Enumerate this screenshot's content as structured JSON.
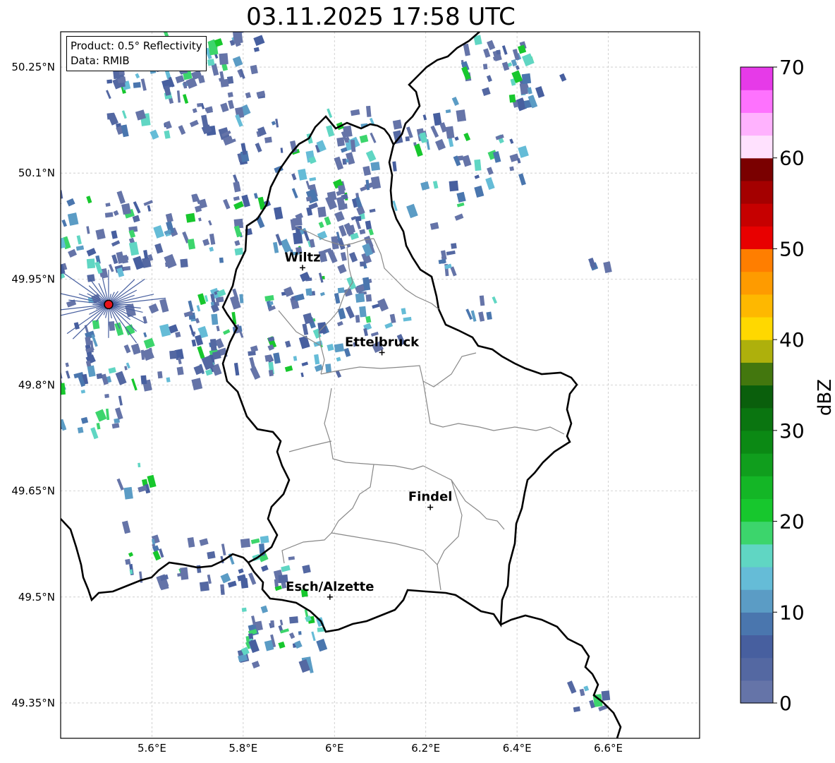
{
  "title": "03.11.2025 17:58 UTC",
  "info_box": {
    "product": "Product: 0.5° Reflectivity",
    "data": "Data: RMIB"
  },
  "map": {
    "lon_range": [
      5.4,
      6.8
    ],
    "lat_range": [
      49.3,
      50.3
    ],
    "lat_ticks": [
      {
        "value": 50.25,
        "label": "50.25°N"
      },
      {
        "value": 50.1,
        "label": "50.1°N"
      },
      {
        "value": 49.95,
        "label": "49.95°N"
      },
      {
        "value": 49.8,
        "label": "49.8°N"
      },
      {
        "value": 49.65,
        "label": "49.65°N"
      },
      {
        "value": 49.5,
        "label": "49.5°N"
      },
      {
        "value": 49.35,
        "label": "49.35°N"
      }
    ],
    "lon_ticks": [
      {
        "value": 5.6,
        "label": "5.6°E"
      },
      {
        "value": 5.8,
        "label": "5.8°E"
      },
      {
        "value": 6.0,
        "label": "6°E"
      },
      {
        "value": 6.2,
        "label": "6.2°E"
      },
      {
        "value": 6.4,
        "label": "6.4°E"
      },
      {
        "value": 6.6,
        "label": "6.6°E"
      }
    ],
    "gridlines": true,
    "cities": [
      {
        "name": "Wiltz",
        "lon": 5.93,
        "lat": 49.966
      },
      {
        "name": "Ettelbruck",
        "lon": 6.104,
        "lat": 49.846
      },
      {
        "name": "Findel",
        "lon": 6.21,
        "lat": 49.627
      },
      {
        "name": "Esch/Alzette",
        "lon": 5.99,
        "lat": 49.5
      }
    ],
    "radar_site": {
      "lon": 5.505,
      "lat": 49.914,
      "color": "#e8131b"
    }
  },
  "colorbar": {
    "label": "dBZ",
    "ticks": [
      "0",
      "10",
      "20",
      "30",
      "40",
      "50",
      "60",
      "70"
    ],
    "colors": [
      "#6574a8",
      "#5468a2",
      "#475f9f",
      "#4a76ae",
      "#5b9cc5",
      "#65bcd7",
      "#60d6c3",
      "#3cd56c",
      "#17c72d",
      "#14b626",
      "#109e1d",
      "#0b8914",
      "#0a7510",
      "#0a5f0c",
      "#43770e",
      "#aeb00c",
      "#ffd800",
      "#feb800",
      "#fe9b00",
      "#ff7e00",
      "#e80000",
      "#c60000",
      "#a40000",
      "#7a0000",
      "#ffe1fe",
      "#ffb2fe",
      "#fe72fe",
      "#e63ae8"
    ]
  }
}
